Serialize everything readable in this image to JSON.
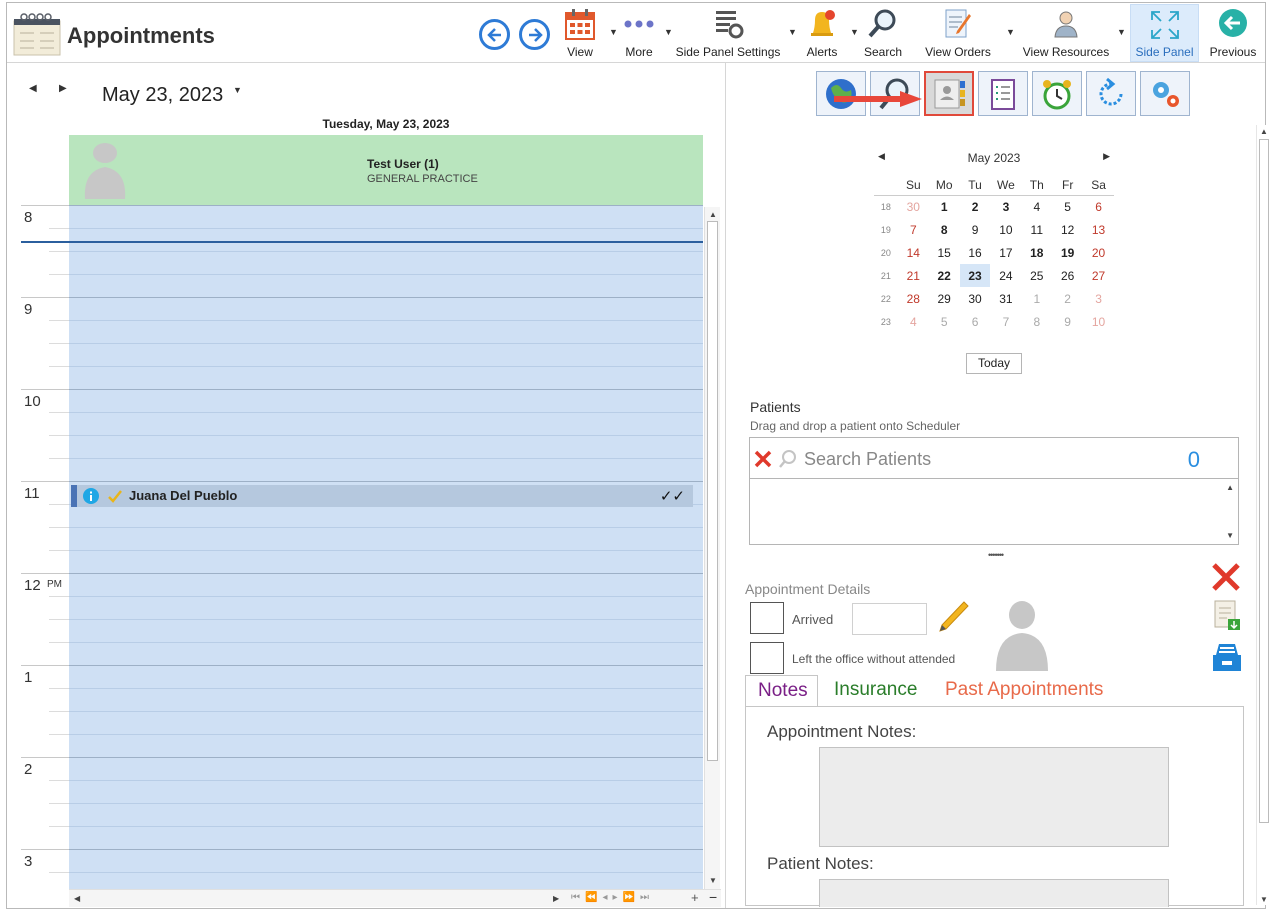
{
  "toolbar": {
    "title": "Appointments",
    "buttons": [
      {
        "label": "View",
        "icon": "calendar-icon"
      },
      {
        "label": "More",
        "icon": "more-dots-icon"
      },
      {
        "label": "Side Panel Settings",
        "icon": "side-panel-settings-icon"
      },
      {
        "label": "Alerts",
        "icon": "bell-icon"
      },
      {
        "label": "Search",
        "icon": "magnifier-icon"
      },
      {
        "label": "View Orders",
        "icon": "orders-icon"
      },
      {
        "label": "View Resources",
        "icon": "resources-icon"
      },
      {
        "label": "Side Panel",
        "icon": "expand-icon"
      },
      {
        "label": "Previous",
        "icon": "previous-arrow-icon"
      }
    ]
  },
  "scheduler": {
    "date": "May 23, 2023",
    "day_header": "Tuesday, May 23, 2023",
    "resource": {
      "name": "Test User (1)",
      "department": "GENERAL PRACTICE"
    },
    "hours": [
      "8",
      "9",
      "10",
      "11",
      "12",
      "1",
      "2",
      "3"
    ],
    "pm_marker": "PM",
    "appointment": {
      "patient": "Juana Del Pueblo",
      "status": "✓✓"
    }
  },
  "side_panel": {
    "mini_calendar": {
      "month": "May 2023",
      "weekdays": [
        "Su",
        "Mo",
        "Tu",
        "We",
        "Th",
        "Fr",
        "Sa"
      ],
      "weeks": [
        {
          "wk": "18",
          "days": [
            "30",
            "1",
            "2",
            "3",
            "4",
            "5",
            "6"
          ]
        },
        {
          "wk": "19",
          "days": [
            "7",
            "8",
            "9",
            "10",
            "11",
            "12",
            "13"
          ]
        },
        {
          "wk": "20",
          "days": [
            "14",
            "15",
            "16",
            "17",
            "18",
            "19",
            "20"
          ]
        },
        {
          "wk": "21",
          "days": [
            "21",
            "22",
            "23",
            "24",
            "25",
            "26",
            "27"
          ]
        },
        {
          "wk": "22",
          "days": [
            "28",
            "29",
            "30",
            "31",
            "1",
            "2",
            "3"
          ]
        },
        {
          "wk": "23",
          "days": [
            "4",
            "5",
            "6",
            "7",
            "8",
            "9",
            "10"
          ]
        }
      ],
      "today_label": "Today"
    },
    "patients": {
      "title": "Patients",
      "hint": "Drag and drop a patient onto Scheduler",
      "search_placeholder": "Search Patients",
      "count": "0"
    },
    "appointment_details": {
      "title": "Appointment Details",
      "arrived_label": "Arrived",
      "left_label": "Left the office without attended"
    },
    "tabs": [
      "Notes",
      "Insurance",
      "Past Appointments"
    ],
    "tab_colors": [
      "#7a1f86",
      "#2a7d2a",
      "#e86a4a"
    ],
    "notes": {
      "appointment_notes_label": "Appointment Notes:",
      "patient_notes_label": "Patient Notes:"
    }
  }
}
